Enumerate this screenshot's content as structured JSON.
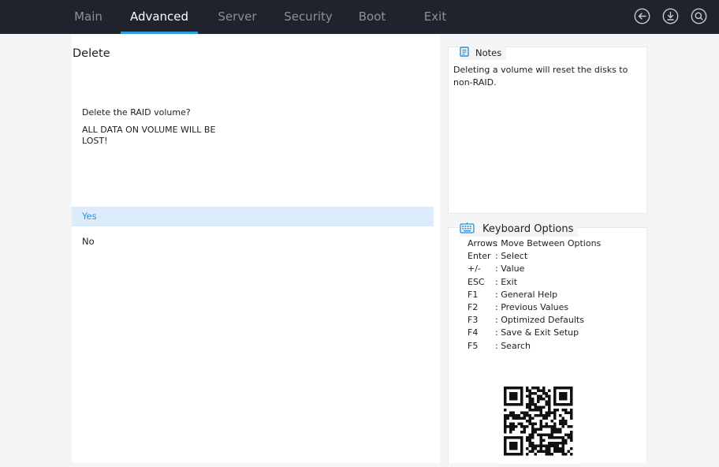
{
  "tabs": [
    {
      "label": "Main",
      "active": false
    },
    {
      "label": "Advanced",
      "active": true
    },
    {
      "label": "Server",
      "active": false
    },
    {
      "label": "Security",
      "active": false
    },
    {
      "label": "Boot",
      "active": false
    },
    {
      "label": "Exit",
      "active": false
    }
  ],
  "top_icons": [
    "back-icon",
    "download-icon",
    "search-icon"
  ],
  "main": {
    "title": "Delete",
    "question": "Delete the RAID volume?",
    "warning": "ALL DATA ON VOLUME WILL BE LOST!",
    "options": [
      {
        "label": "Yes",
        "selected": true
      },
      {
        "label": "No",
        "selected": false
      }
    ]
  },
  "notes": {
    "title": "Notes",
    "text": "Deleting a volume will reset the disks to non-RAID."
  },
  "keyboard": {
    "title": "Keyboard Options",
    "items": [
      {
        "key": "Arrows",
        "desc": ": Move Between Options"
      },
      {
        "key": "Enter",
        "desc": ": Select"
      },
      {
        "key": "+/-",
        "desc": ": Value"
      },
      {
        "key": "ESC",
        "desc": ": Exit"
      },
      {
        "key": "F1",
        "desc": ": General Help"
      },
      {
        "key": "F2",
        "desc": ": Previous Values"
      },
      {
        "key": "F3",
        "desc": ": Optimized Defaults"
      },
      {
        "key": "F4",
        "desc": ": Save & Exit Setup"
      },
      {
        "key": "F5",
        "desc": ": Search"
      }
    ]
  },
  "colors": {
    "accent": "#2f9bdb",
    "topbar": "#20232c",
    "selected_bg": "#dcecfa",
    "selected_text": "#2f8fd2"
  }
}
